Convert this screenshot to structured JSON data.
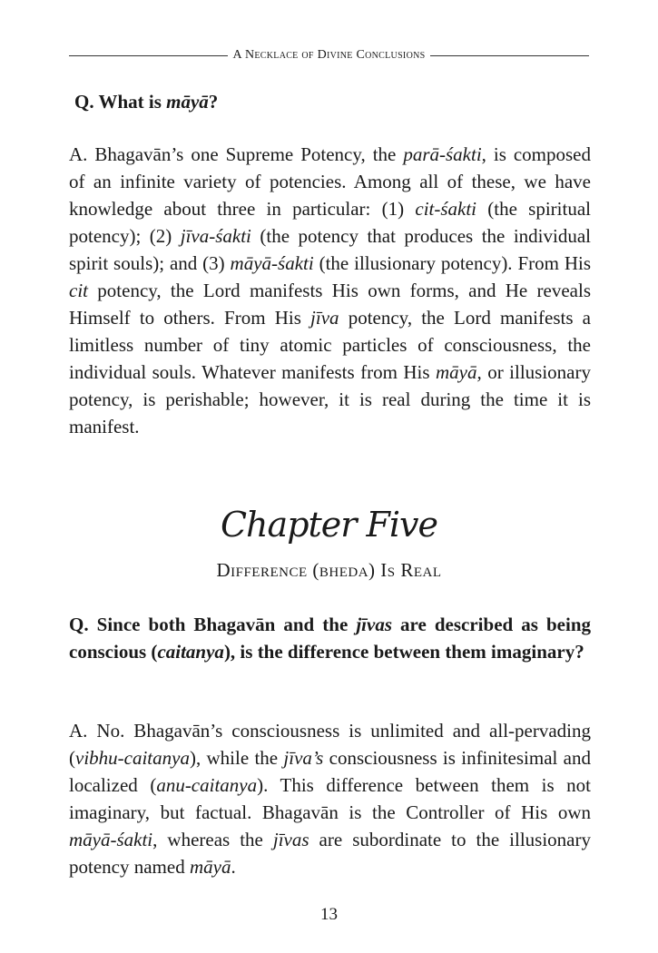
{
  "running_head": "A Necklace of Divine Conclusions",
  "q1": {
    "prefix": "Q. What is ",
    "term": "māyā",
    "suffix": "?"
  },
  "a1": {
    "s1": "A. Bhagavān’s one Supreme Potency, the ",
    "t1": "parā-śakti",
    "s2": ", is composed of an infinite variety of potencies. Among all of these, we have knowledge about three in particular: (1) ",
    "t2": "cit-śakti",
    "s3": " (the spiritual potency); (2) ",
    "t3": "jīva-śakti",
    "s4": " (the potency that produces the individual spirit souls); and (3) ",
    "t4": "māyā-śakti",
    "s5": " (the illusionary potency). From His ",
    "t5": "cit",
    "s6": " potency, the Lord manifests His own forms, and He reveals Himself to others. From His ",
    "t6": "jīva",
    "s7": " potency, the Lord manifests a limitless number of tiny atomic particles of consciousness, the individual souls. Whatever manifests from His ",
    "t7": "māyā,",
    "s8": " or illusionary potency, is perishable; however, it is real during the time it is manifest."
  },
  "chapter": {
    "title": "Chapter Five",
    "subtitle": "Difference (bheda) Is Real"
  },
  "q2": {
    "s1": "Q. Since both Bhagavān and the ",
    "t1": "jīvas",
    "s2": " are described as being conscious (",
    "t2": "caitanya",
    "s3": "), is the difference between them imaginary?"
  },
  "a2": {
    "s1": "A. No. Bhagavān’s consciousness is unlimited and all-pervading (",
    "t1": "vibhu-caitanya",
    "s2": "), while the ",
    "t2": "jīva’s",
    "s3": " consciousness is infinitesimal and localized (",
    "t3": "anu-caitanya",
    "s4": "). This difference between them is not imaginary, but factual. Bhagavān is the Controller of His own ",
    "t4": "māyā-śakti",
    "s5": ", whereas the ",
    "t5": "jīvas",
    "s6": " are subordinate to the illusionary potency named ",
    "t6": "māyā",
    "s7": "."
  },
  "page_number": "13"
}
